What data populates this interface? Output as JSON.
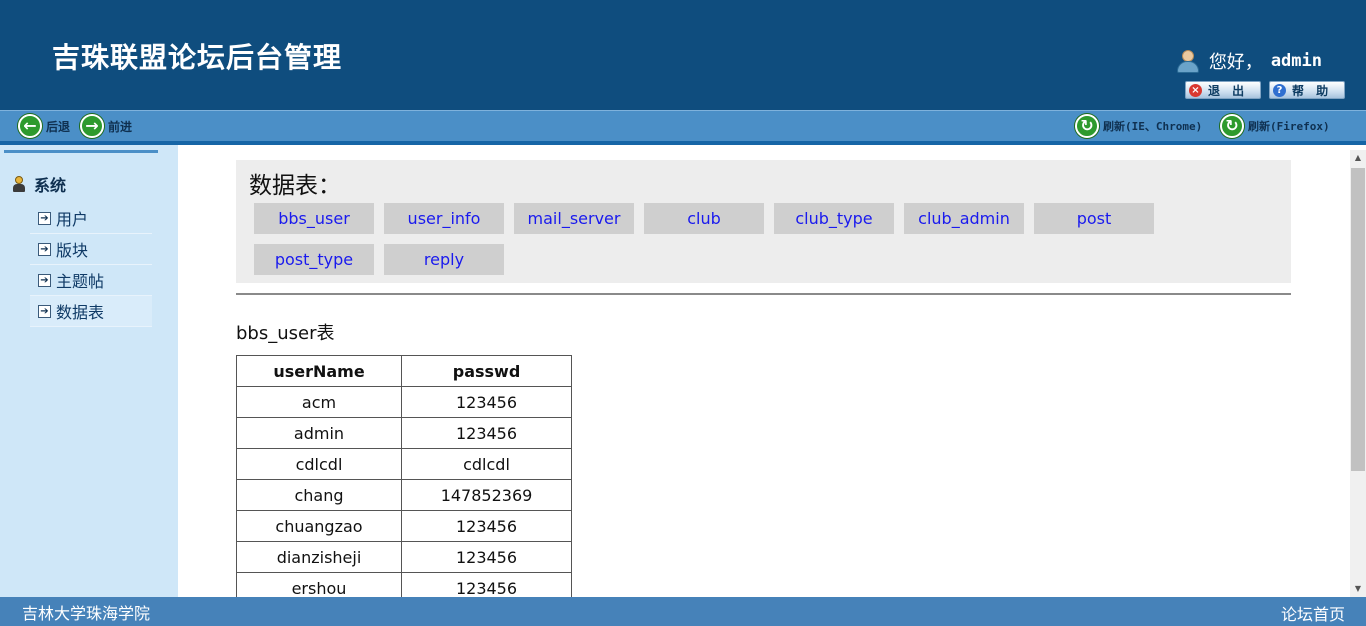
{
  "header": {
    "title": "吉珠联盟论坛后台管理",
    "greeting_prefix": "您好，",
    "username": "admin",
    "logout_label": "退 出",
    "help_label": "帮 助"
  },
  "toolbar": {
    "back_label": "后退",
    "forward_label": "前进",
    "refresh_ie_label": "刷新(IE、Chrome)",
    "refresh_ff_label": "刷新(Firefox)"
  },
  "sidebar": {
    "section_label": "系统",
    "items": [
      {
        "label": "用户"
      },
      {
        "label": "版块"
      },
      {
        "label": "主题帖"
      },
      {
        "label": "数据表"
      }
    ]
  },
  "main": {
    "tables_title": "数据表：",
    "table_buttons": [
      "bbs_user",
      "user_info",
      "mail_server",
      "club",
      "club_type",
      "club_admin",
      "post",
      "post_type",
      "reply"
    ],
    "table_caption": "bbs_user表",
    "columns": [
      "userName",
      "passwd"
    ],
    "rows": [
      [
        "acm",
        "123456"
      ],
      [
        "admin",
        "123456"
      ],
      [
        "cdlcdl",
        "cdlcdl"
      ],
      [
        "chang",
        "147852369"
      ],
      [
        "chuangzao",
        "123456"
      ],
      [
        "dianzisheji",
        "123456"
      ],
      [
        "ershou",
        "123456"
      ]
    ]
  },
  "footer": {
    "left_text": "吉林大学珠海学院",
    "right_link": "论坛首页"
  },
  "colors": {
    "header_bg": "#0f4d7e",
    "toolbar_bg": "#4b8fc7",
    "sidebar_bg": "#cfe7f8",
    "footer_bg": "#4682b9",
    "link": "#1a1aee"
  }
}
